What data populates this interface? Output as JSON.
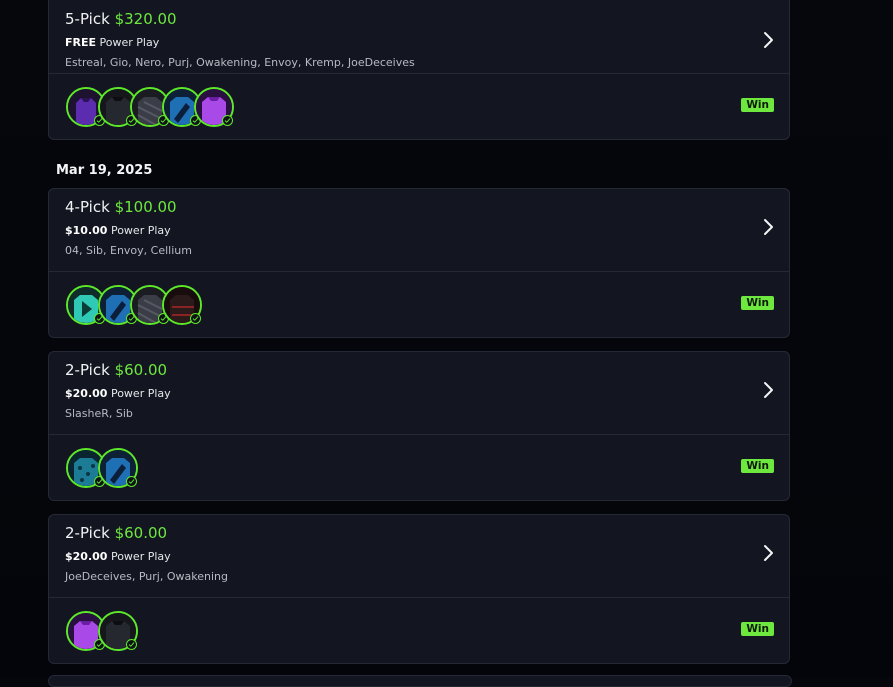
{
  "date_header": "Mar 19, 2025",
  "cards": [
    {
      "pick": "5-Pick",
      "amount": "$320.00",
      "stake": "FREE",
      "mode": "Power Play",
      "players": "Estreal, Gio, Nero, Purj, Owakening, Envoy, Kremp, JoeDeceives",
      "result": "Win",
      "avatars": [
        "purple-jersey",
        "black-jersey",
        "grey-jersey",
        "blue-jersey",
        "violet-jersey"
      ]
    },
    {
      "pick": "4-Pick",
      "amount": "$100.00",
      "stake": "$10.00",
      "mode": "Power Play",
      "players": "04, Sib, Envoy, Cellium",
      "result": "Win",
      "avatars": [
        "teal-jersey",
        "blue-jersey",
        "grey-jersey",
        "red-black-jersey"
      ]
    },
    {
      "pick": "2-Pick",
      "amount": "$60.00",
      "stake": "$20.00",
      "mode": "Power Play",
      "players": "SlasheR, Sib",
      "result": "Win",
      "avatars": [
        "cyan-pattern-jersey",
        "blue-jersey"
      ]
    },
    {
      "pick": "2-Pick",
      "amount": "$60.00",
      "stake": "$20.00",
      "mode": "Power Play",
      "players": "JoeDeceives, Purj, Owakening",
      "result": "Win",
      "avatars": [
        "violet-jersey",
        "black-jersey"
      ]
    }
  ],
  "colors": {
    "accent_green": "#6ee83f",
    "card_bg": "#131620",
    "page_bg": "#05070c"
  }
}
